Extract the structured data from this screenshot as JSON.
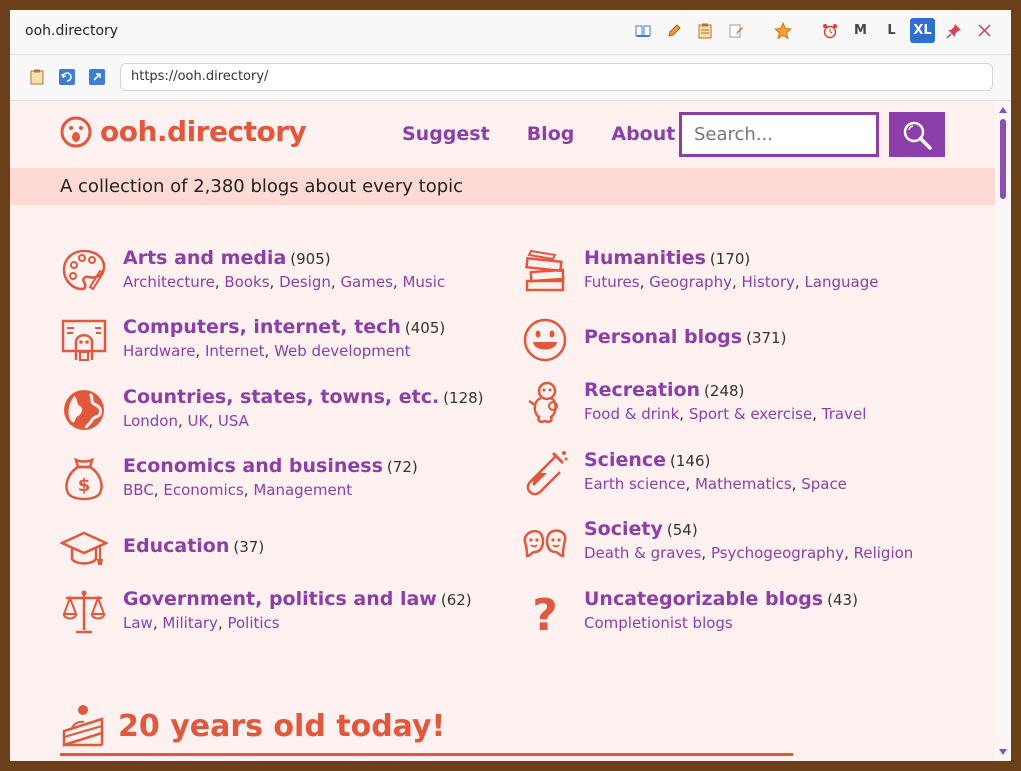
{
  "window": {
    "title": "ooh.directory",
    "toolbar": {
      "size_m": "M",
      "size_l": "L",
      "size_xl": "XL"
    },
    "url": "https://ooh.directory/"
  },
  "site": {
    "logo": "ooh.directory",
    "nav": [
      "Suggest",
      "Blog",
      "About"
    ],
    "search_placeholder": "Search...",
    "tagline": "A collection of 2,380 blogs about every topic"
  },
  "categories_left": [
    {
      "name": "Arts and media",
      "count": "(905)",
      "subs": [
        "Architecture",
        "Books",
        "Design",
        "Games",
        "Music"
      ],
      "icon": "palette-icon"
    },
    {
      "name": "Computers, internet, tech",
      "count": "(405)",
      "subs": [
        "Hardware",
        "Internet",
        "Web development"
      ],
      "icon": "computer-icon"
    },
    {
      "name": "Countries, states, towns, etc.",
      "count": "(128)",
      "subs": [
        "London",
        "UK",
        "USA"
      ],
      "icon": "globe-icon"
    },
    {
      "name": "Economics and business",
      "count": "(72)",
      "subs": [
        "BBC",
        "Economics",
        "Management"
      ],
      "icon": "money-bag-icon"
    },
    {
      "name": "Education",
      "count": "(37)",
      "subs": [],
      "icon": "graduation-cap-icon"
    },
    {
      "name": "Government, politics and law",
      "count": "(62)",
      "subs": [
        "Law",
        "Military",
        "Politics"
      ],
      "icon": "scales-icon"
    }
  ],
  "categories_right": [
    {
      "name": "Humanities",
      "count": "(170)",
      "subs": [
        "Futures",
        "Geography",
        "History",
        "Language"
      ],
      "icon": "books-icon"
    },
    {
      "name": "Personal blogs",
      "count": "(371)",
      "subs": [],
      "icon": "smiley-icon"
    },
    {
      "name": "Recreation",
      "count": "(248)",
      "subs": [
        "Food & drink",
        "Sport & exercise",
        "Travel"
      ],
      "icon": "creature-icon"
    },
    {
      "name": "Science",
      "count": "(146)",
      "subs": [
        "Earth science",
        "Mathematics",
        "Space"
      ],
      "icon": "test-tube-icon"
    },
    {
      "name": "Society",
      "count": "(54)",
      "subs": [
        "Death & graves",
        "Psychogeography",
        "Religion"
      ],
      "icon": "faces-icon"
    },
    {
      "name": "Uncategorizable blogs",
      "count": "(43)",
      "subs": [
        "Completionist blogs"
      ],
      "icon": "question-mark-icon"
    }
  ],
  "anniversary": {
    "title": "20 years old today!",
    "icon": "cake-icon"
  },
  "colors": {
    "accent_orange": "#e2583c",
    "accent_purple": "#8c3fa8",
    "page_bg": "#fff1f0",
    "banner_bg": "#ffd9d3"
  }
}
